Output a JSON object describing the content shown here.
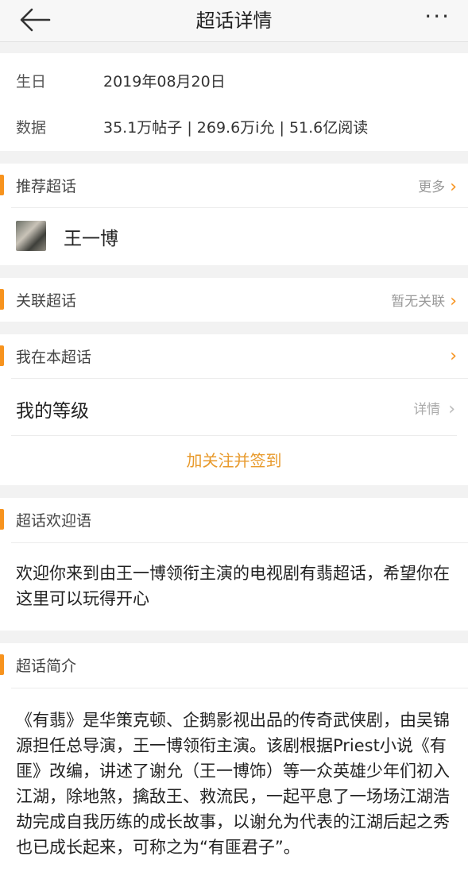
{
  "nav": {
    "title": "超话详情",
    "back_icon": "arrow-left-icon",
    "more_icon": "more-dots-icon",
    "more_glyph": "···"
  },
  "info": {
    "birthday_label": "生日",
    "birthday_value": "2019年08月20日",
    "stats_label": "数据",
    "stats_value": "35.1万帖子 | 269.6万i允 | 51.6亿阅读"
  },
  "recommend": {
    "title": "推荐超话",
    "more": "更多",
    "star_name": "王一博"
  },
  "related": {
    "title": "关联超话",
    "status": "暂无关联"
  },
  "me": {
    "title": "我在本超话",
    "level_label": "我的等级",
    "level_detail": "详情",
    "follow_button": "加关注并签到"
  },
  "welcome": {
    "title": "超话欢迎语",
    "text": "欢迎你来到由王一博领衔主演的电视剧有翡超话，希望你在这里可以玩得开心"
  },
  "intro": {
    "title": "超话简介",
    "text": "《有翡》是华策克顿、企鹅影视出品的传奇武侠剧，由吴锦源担任总导演，王一博领衔主演。该剧根据Priest小说《有匪》改编，讲述了谢允（王一博饰）等一众英雄少年们初入江湖，除地煞，擒敌王、救流民，一起平息了一场场江湖浩劫完成自我历练的成长故事，以谢允为代表的江湖后起之秀也已成长起来，可称之为“有匪君子”。"
  },
  "colors": {
    "accent": "#f7931e",
    "follow_text": "#e89a2c",
    "gap": "#f2f2f2"
  },
  "chevron": "›"
}
